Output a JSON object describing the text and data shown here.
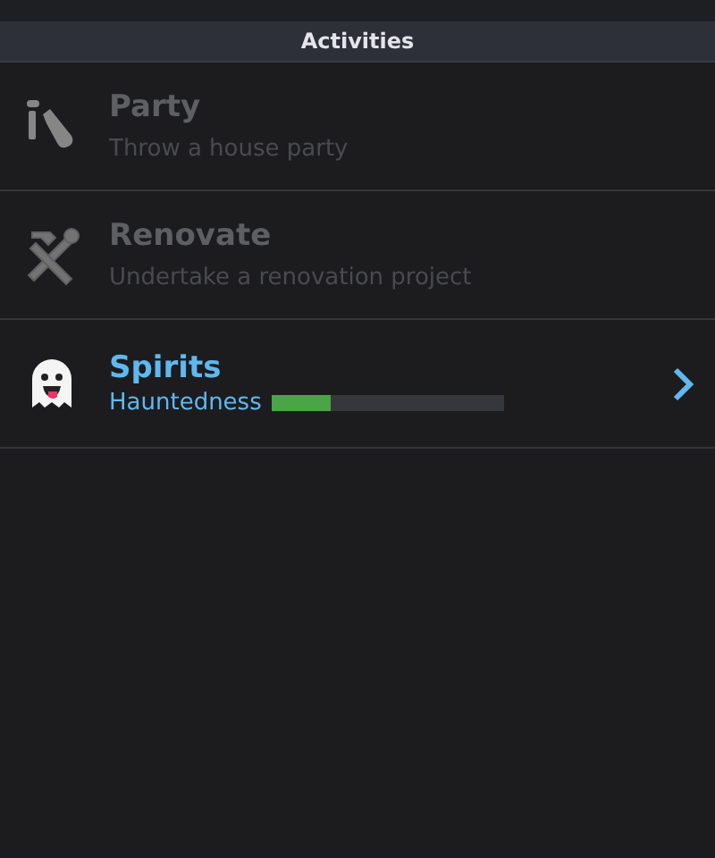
{
  "header": {
    "title": "Activities"
  },
  "activities": [
    {
      "kind": "description",
      "title": "Party",
      "subtitle": "Throw a house party",
      "disabled": true,
      "chevron": false
    },
    {
      "kind": "description",
      "title": "Renovate",
      "subtitle": "Undertake a renovation project",
      "disabled": true,
      "chevron": false
    },
    {
      "kind": "meter",
      "title": "Spirits",
      "meter_label": "Hauntedness",
      "level": 0.25,
      "disabled": false,
      "chevron": true
    }
  ]
}
